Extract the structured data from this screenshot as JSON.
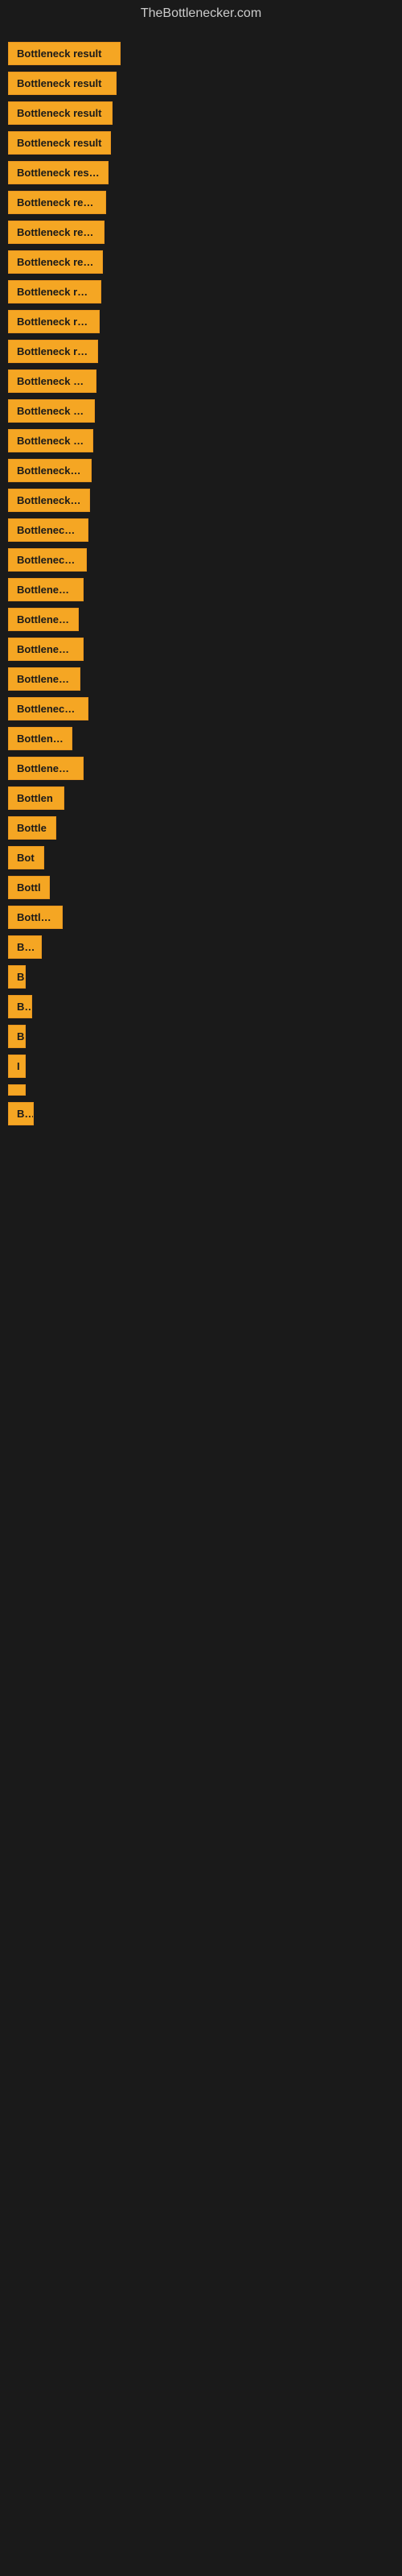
{
  "site": {
    "title": "TheBottlenecker.com"
  },
  "items": [
    {
      "label": "Bottleneck result",
      "width": 140
    },
    {
      "label": "Bottleneck result",
      "width": 135
    },
    {
      "label": "Bottleneck result",
      "width": 130
    },
    {
      "label": "Bottleneck result",
      "width": 128
    },
    {
      "label": "Bottleneck result",
      "width": 125
    },
    {
      "label": "Bottleneck result",
      "width": 122
    },
    {
      "label": "Bottleneck result",
      "width": 120
    },
    {
      "label": "Bottleneck result",
      "width": 118
    },
    {
      "label": "Bottleneck result",
      "width": 116
    },
    {
      "label": "Bottleneck result",
      "width": 114
    },
    {
      "label": "Bottleneck result",
      "width": 112
    },
    {
      "label": "Bottleneck result",
      "width": 110
    },
    {
      "label": "Bottleneck result",
      "width": 108
    },
    {
      "label": "Bottleneck result",
      "width": 106
    },
    {
      "label": "Bottleneck result",
      "width": 104
    },
    {
      "label": "Bottleneck result",
      "width": 102
    },
    {
      "label": "Bottleneck result",
      "width": 100
    },
    {
      "label": "Bottleneck result",
      "width": 98
    },
    {
      "label": "Bottleneck resu",
      "width": 94
    },
    {
      "label": "Bottleneck r",
      "width": 88
    },
    {
      "label": "Bottleneck resu",
      "width": 94
    },
    {
      "label": "Bottleneck re",
      "width": 90
    },
    {
      "label": "Bottleneck result",
      "width": 100
    },
    {
      "label": "Bottleneck",
      "width": 80
    },
    {
      "label": "Bottleneck resu",
      "width": 94
    },
    {
      "label": "Bottlen",
      "width": 70
    },
    {
      "label": "Bottle",
      "width": 60
    },
    {
      "label": "Bot",
      "width": 45
    },
    {
      "label": "Bottl",
      "width": 52
    },
    {
      "label": "Bottlene",
      "width": 68
    },
    {
      "label": "Bot",
      "width": 42
    },
    {
      "label": "B",
      "width": 20
    },
    {
      "label": "Bo",
      "width": 30
    },
    {
      "label": "B",
      "width": 16
    },
    {
      "label": "I",
      "width": 10
    },
    {
      "label": "",
      "width": 20
    },
    {
      "label": "Bo",
      "width": 32
    }
  ]
}
